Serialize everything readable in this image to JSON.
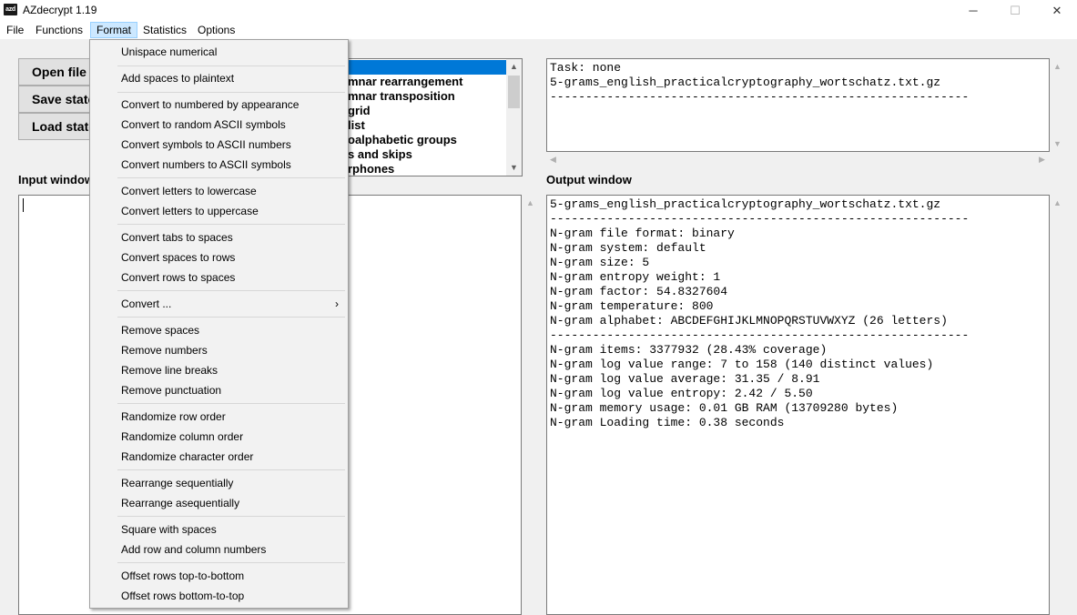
{
  "window": {
    "title": "AZdecrypt 1.19",
    "icon_label": "azd",
    "minimize_glyph": "─",
    "maximize_glyph": "☐",
    "close_glyph": "✕"
  },
  "menubar": {
    "items": [
      "File",
      "Functions",
      "Format",
      "Statistics",
      "Options"
    ],
    "active": "Format"
  },
  "buttons": {
    "open": "Open file",
    "save": "Save state",
    "load": "Load state"
  },
  "labels": {
    "input_window": "Input window",
    "output_window": "Output window"
  },
  "solver_list": {
    "items": [
      "",
      "mnar rearrangement",
      "mnar transposition",
      "grid",
      "list",
      "oalphabetic groups",
      "s and skips",
      "rphones"
    ],
    "selected_index": 0
  },
  "task_box": {
    "lines": [
      "Task: none",
      "5-grams_english_practicalcryptography_wortschatz.txt.gz",
      "-----------------------------------------------------------"
    ]
  },
  "output_box": {
    "lines": [
      "5-grams_english_practicalcryptography_wortschatz.txt.gz",
      "-----------------------------------------------------------",
      "N-gram file format: binary",
      "N-gram system: default",
      "N-gram size: 5",
      "N-gram entropy weight: 1",
      "N-gram factor: 54.8327604",
      "N-gram temperature: 800",
      "N-gram alphabet: ABCDEFGHIJKLMNOPQRSTUVWXYZ (26 letters)",
      "-----------------------------------------------------------",
      "N-gram items: 3377932 (28.43% coverage)",
      "N-gram log value range: 7 to 158 (140 distinct values)",
      "N-gram log value average: 31.35 / 8.91",
      "N-gram log value entropy: 2.42 / 5.50",
      "N-gram memory usage: 0.01 GB RAM (13709280 bytes)",
      "N-gram Loading time: 0.38 seconds"
    ]
  },
  "format_menu": {
    "groups": [
      [
        "Unispace numerical"
      ],
      [
        "Add spaces to plaintext"
      ],
      [
        "Convert to numbered by appearance",
        "Convert to random ASCII symbols",
        "Convert symbols to ASCII numbers",
        "Convert numbers to ASCII symbols"
      ],
      [
        "Convert letters to lowercase",
        "Convert letters to uppercase"
      ],
      [
        "Convert tabs to spaces",
        "Convert spaces to rows",
        "Convert rows to spaces"
      ],
      [
        "Convert ..."
      ],
      [
        "Remove spaces",
        "Remove numbers",
        "Remove line breaks",
        "Remove punctuation"
      ],
      [
        "Randomize row order",
        "Randomize column order",
        "Randomize character order"
      ],
      [
        "Rearrange sequentially",
        "Rearrange asequentially"
      ],
      [
        "Square with spaces",
        "Add row and column numbers"
      ],
      [
        "Offset rows top-to-bottom",
        "Offset rows bottom-to-top"
      ]
    ],
    "submenu_items": [
      "Convert ..."
    ],
    "submenu_glyph": "›"
  },
  "scroll_glyphs": {
    "up": "▲",
    "down": "▼",
    "left": "◀",
    "right": "▶"
  }
}
